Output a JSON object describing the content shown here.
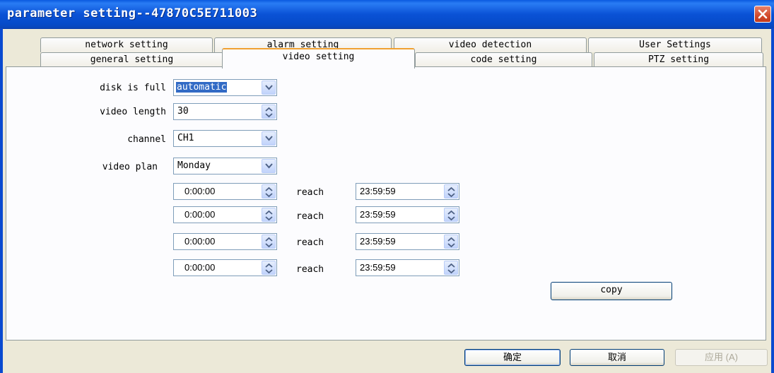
{
  "window": {
    "title": "parameter setting--47870C5E711003"
  },
  "tabs_row1": [
    {
      "label": "network setting"
    },
    {
      "label": "alarm setting"
    },
    {
      "label": "video detection"
    },
    {
      "label": "User Settings"
    }
  ],
  "tabs_row2": [
    {
      "label": "general setting"
    },
    {
      "label": "video setting"
    },
    {
      "label": "code setting"
    },
    {
      "label": "PTZ setting"
    }
  ],
  "active_tab": "video setting",
  "form": {
    "disk_full_label": "disk is full",
    "disk_full_value": "automatic",
    "video_length_label": "video length",
    "video_length_value": "30",
    "channel_label": "channel",
    "channel_value": "CH1",
    "video_plan_label": "video plan",
    "video_plan_value": "Monday"
  },
  "schedule": [
    {
      "start": "0:00:00",
      "reach": "reach",
      "end": "23:59:59"
    },
    {
      "start": "0:00:00",
      "reach": "reach",
      "end": "23:59:59"
    },
    {
      "start": "0:00:00",
      "reach": "reach",
      "end": "23:59:59"
    },
    {
      "start": "0:00:00",
      "reach": "reach",
      "end": "23:59:59"
    }
  ],
  "copy_label": "copy",
  "footer": {
    "ok_label": "确定",
    "cancel_label": "取消",
    "apply_label": "应用 (A)"
  },
  "colors": {
    "titlebar": "#0a52d6",
    "active_tab_accent": "#f0a030",
    "selection": "#316ac5"
  }
}
